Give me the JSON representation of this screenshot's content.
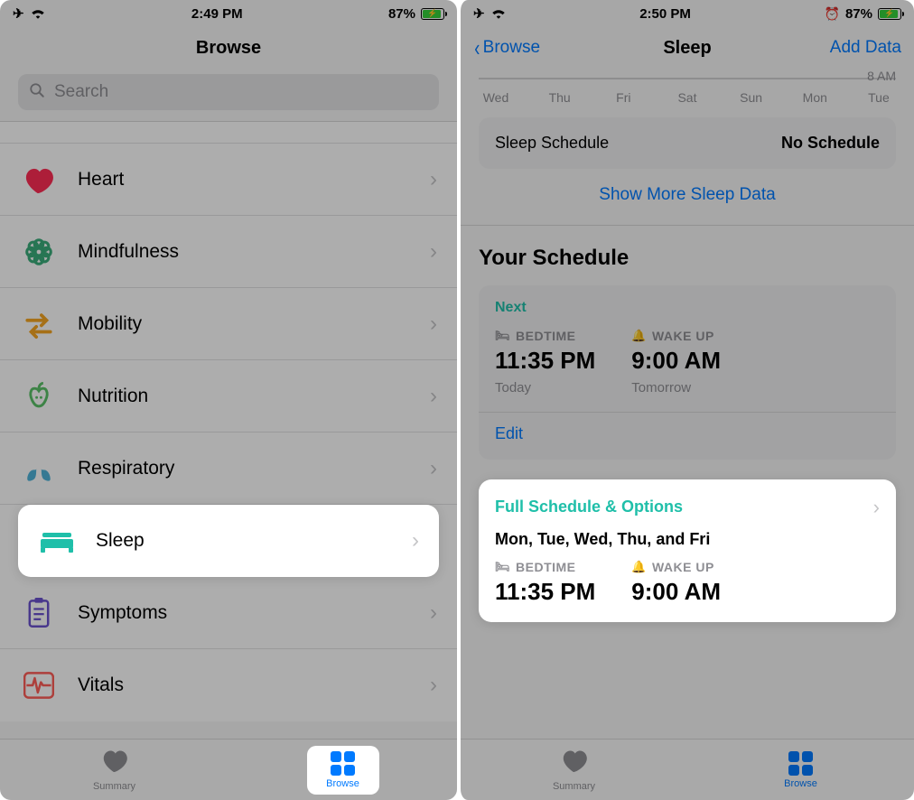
{
  "left": {
    "status": {
      "time": "2:49 PM",
      "battery": "87%"
    },
    "title": "Browse",
    "search_placeholder": "Search",
    "rows": {
      "heart": "Heart",
      "mindfulness": "Mindfulness",
      "mobility": "Mobility",
      "nutrition": "Nutrition",
      "respiratory": "Respiratory",
      "sleep": "Sleep",
      "symptoms": "Symptoms",
      "vitals": "Vitals"
    },
    "tabs": {
      "summary": "Summary",
      "browse": "Browse"
    }
  },
  "right": {
    "status": {
      "time": "2:50 PM",
      "battery": "87%"
    },
    "back": "Browse",
    "title": "Sleep",
    "add_data": "Add Data",
    "am_label": "8 AM",
    "days": [
      "Wed",
      "Thu",
      "Fri",
      "Sat",
      "Sun",
      "Mon",
      "Tue"
    ],
    "schedule_card": {
      "label": "Sleep Schedule",
      "value": "No Schedule"
    },
    "show_more": "Show More Sleep Data",
    "your_schedule": "Your Schedule",
    "next_card": {
      "next": "Next",
      "bedtime_lab": "BEDTIME",
      "bedtime": "11:35 PM",
      "bedtime_sub": "Today",
      "wake_lab": "WAKE UP",
      "wake": "9:00 AM",
      "wake_sub": "Tomorrow",
      "edit": "Edit"
    },
    "full_card": {
      "title": "Full Schedule & Options",
      "days": "Mon, Tue, Wed, Thu, and Fri",
      "bedtime_lab": "BEDTIME",
      "bedtime": "11:35 PM",
      "wake_lab": "WAKE UP",
      "wake": "9:00 AM"
    },
    "tabs": {
      "summary": "Summary",
      "browse": "Browse"
    }
  }
}
